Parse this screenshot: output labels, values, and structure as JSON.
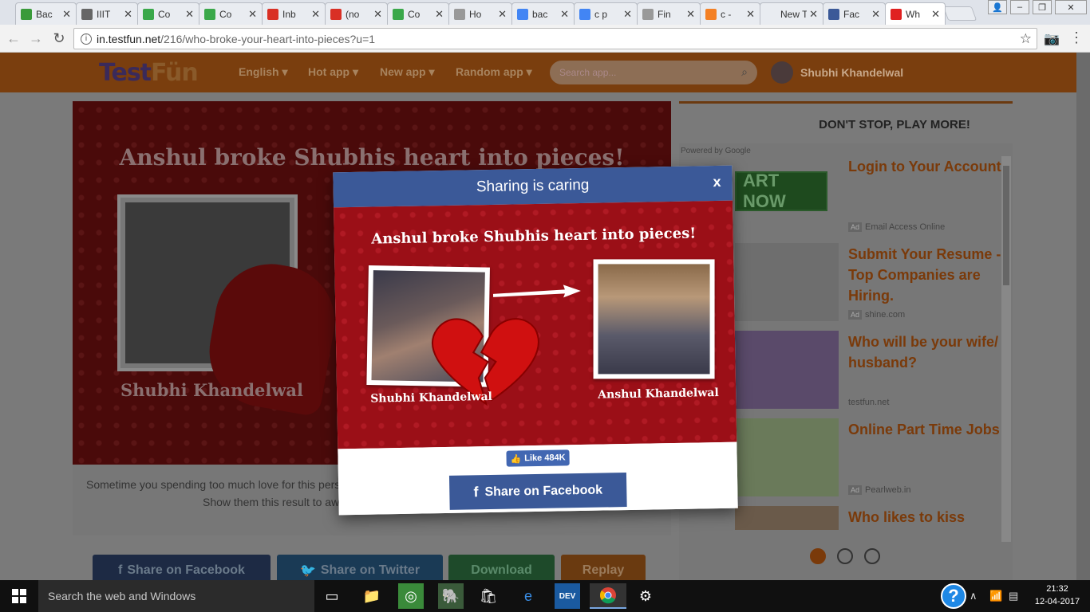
{
  "browser": {
    "tabs": [
      {
        "title": "Bac",
        "fav": "#3a9a3a"
      },
      {
        "title": "IIIT",
        "fav": "#666666"
      },
      {
        "title": "Co",
        "fav": "#3aa84a"
      },
      {
        "title": "Co",
        "fav": "#3aa84a"
      },
      {
        "title": "Inb",
        "fav": "#d93025"
      },
      {
        "title": "(no",
        "fav": "#d93025"
      },
      {
        "title": "Co",
        "fav": "#3aa84a"
      },
      {
        "title": "Ho",
        "fav": "#999999"
      },
      {
        "title": "bac",
        "fav": "#4285f4"
      },
      {
        "title": "c p",
        "fav": "#4285f4"
      },
      {
        "title": "Fin",
        "fav": "#999999"
      },
      {
        "title": "c -",
        "fav": "#f48024"
      },
      {
        "title": "New Ta",
        "fav": ""
      },
      {
        "title": "Fac",
        "fav": "#3b5998"
      },
      {
        "title": "Wh",
        "fav": "#e02020"
      }
    ],
    "url_host": "in.testfun.net",
    "url_path": "/216/who-broke-your-heart-into-pieces?u=1"
  },
  "site": {
    "logo_main": "Test",
    "logo_accent": "Fün",
    "nav": [
      "English ▾",
      "Hot app ▾",
      "New app ▾",
      "Random app ▾"
    ],
    "search_placeholder": "Search app...",
    "user_name": "Shubhi Khandelwal"
  },
  "result": {
    "title": "Anshul broke Shubhis heart into pieces!",
    "left_name": "Shubhi Khandelwal",
    "right_name": "Anshul Khandelwal",
    "desc_line1": "Sometime you spending too much love for this person,",
    "desc_line2": "Show them this result to awa",
    "buttons": {
      "facebook": "Share on Facebook",
      "twitter": "Share on Twitter",
      "download": "Download",
      "replay": "Replay"
    }
  },
  "sidebar": {
    "heading": "DON'T STOP, PLAY MORE!",
    "powered": "Powered by Google",
    "start_now": "ART NOW",
    "ads": [
      {
        "title": "Login to Your Account",
        "source": "Email Access Online",
        "ad_badge": true
      },
      {
        "title": "Submit Your Resume - Top Companies are Hiring.",
        "source": "shine.com",
        "ad_badge": true
      },
      {
        "title": "Who will be your wife/ husband?",
        "source": "testfun.net",
        "ad_badge": false
      },
      {
        "title": "Online Part Time Jobs",
        "source": "Pearlweb.in",
        "ad_badge": true
      },
      {
        "title": "Who likes to kiss",
        "source": "",
        "ad_badge": false
      }
    ],
    "ad_badge_text": "Ad"
  },
  "modal": {
    "header": "Sharing is caring",
    "close": "x",
    "like_label": "Like 484K",
    "share_label": "Share on Facebook"
  },
  "taskbar": {
    "search_text": "Search the web and Windows",
    "time": "21:32",
    "date": "12-04-2017"
  }
}
